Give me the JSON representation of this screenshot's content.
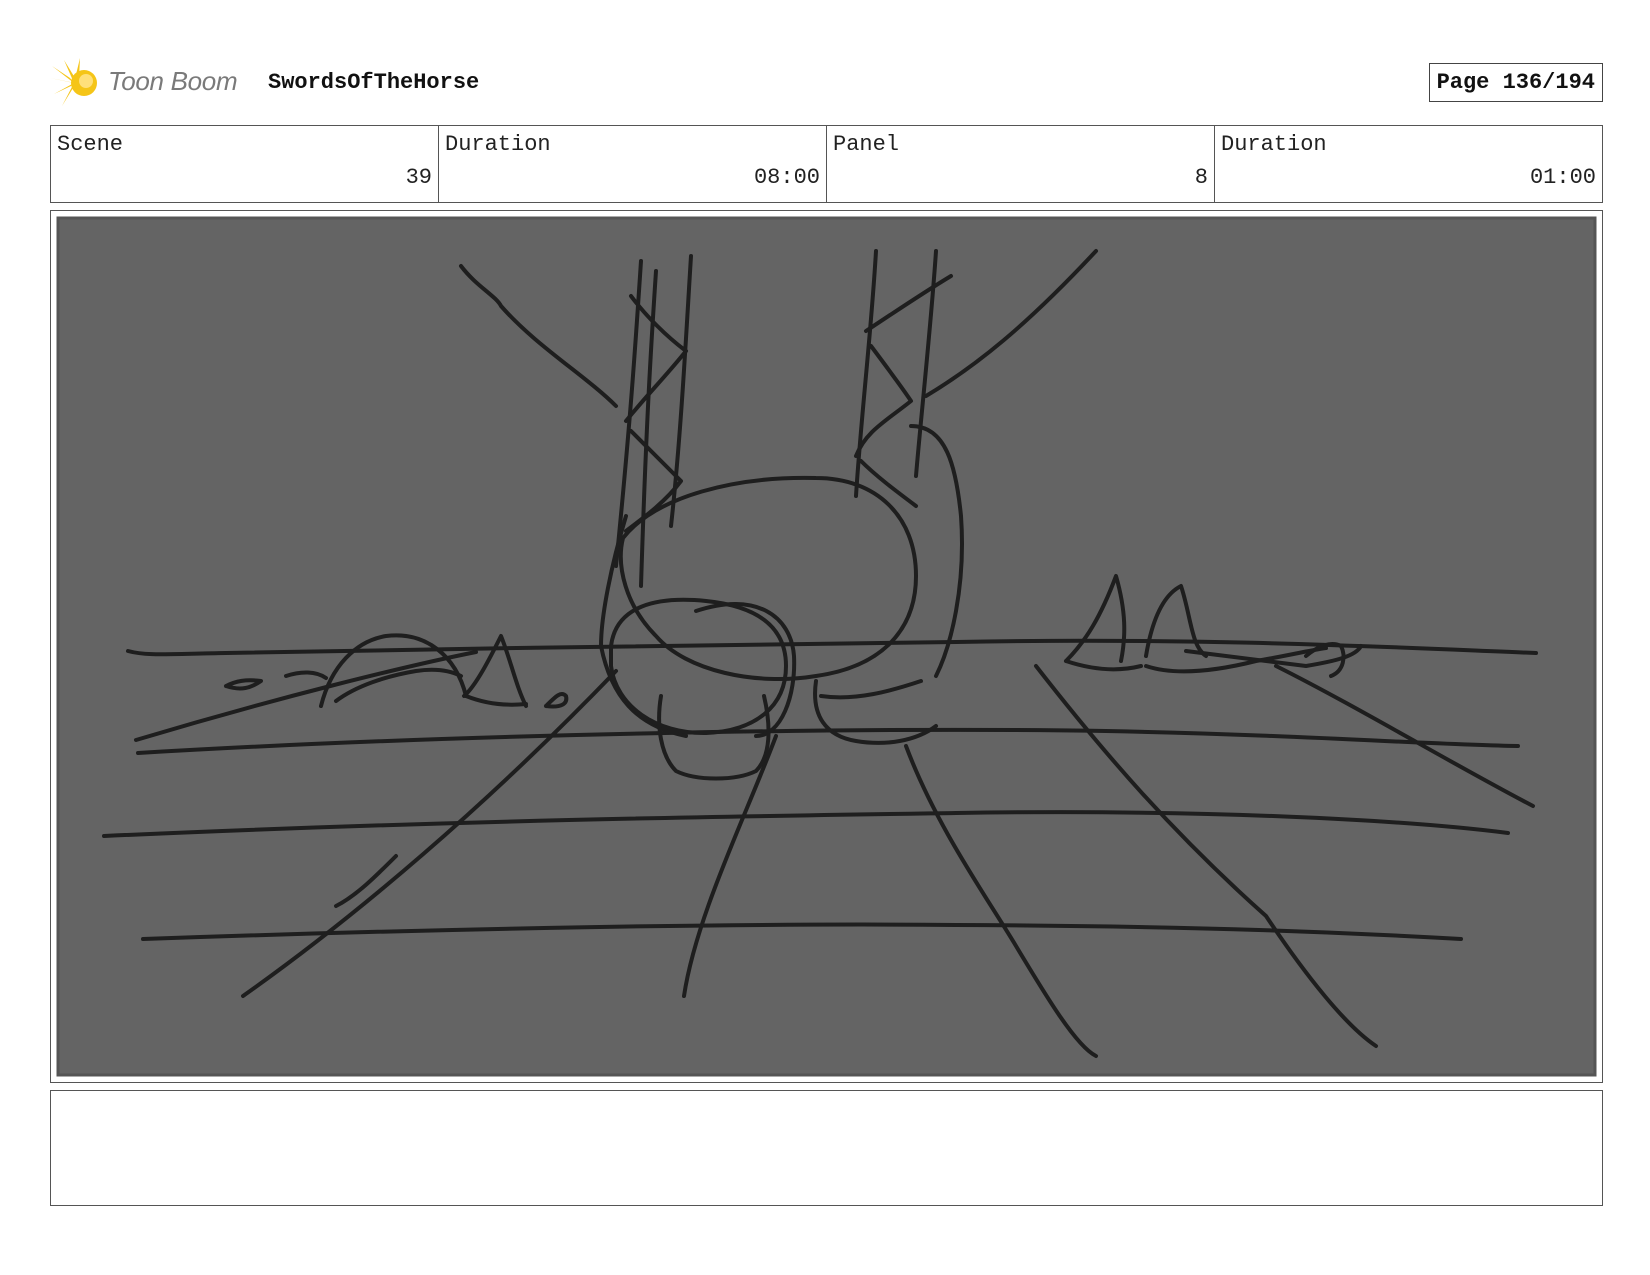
{
  "header": {
    "logo_text": "Toon Boom",
    "project_title": "SwordsOfTheHorse",
    "page_label": "Page 136/194"
  },
  "info": [
    {
      "label": "Scene",
      "value": "39"
    },
    {
      "label": "Duration",
      "value": "08:00"
    },
    {
      "label": "Panel",
      "value": "8"
    },
    {
      "label": "Duration",
      "value": "01:00"
    }
  ],
  "notes": {
    "text": ""
  },
  "colors": {
    "panel_fill": "#646464",
    "sketch_stroke": "#1e1e1e",
    "logo_yellow": "#f5c518",
    "logo_text": "#7a7a7a"
  }
}
